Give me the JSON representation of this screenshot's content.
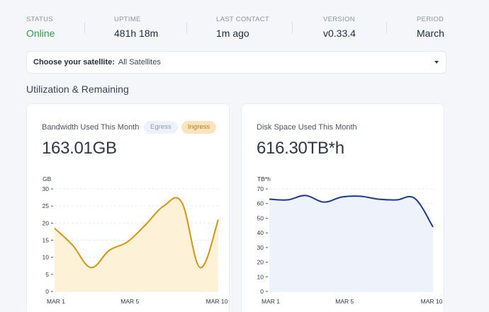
{
  "status": {
    "items": [
      {
        "label": "STATUS",
        "value": "Online"
      },
      {
        "label": "UPTIME",
        "value": "481h 18m"
      },
      {
        "label": "LAST CONTACT",
        "value": "1m ago"
      },
      {
        "label": "VERSION",
        "value": "v0.33.4"
      },
      {
        "label": "PERIOD",
        "value": "March"
      }
    ]
  },
  "satellite_selector": {
    "label": "Choose your satellite:",
    "value": "All Satellites"
  },
  "section_title": "Utilization & Remaining",
  "bandwidth_card": {
    "title": "Bandwidth Used This Month",
    "value": "163.01GB",
    "egress_label": "Egress",
    "ingress_label": "Ingress"
  },
  "disk_card": {
    "title": "Disk Space Used This Month",
    "value": "616.30TB*h"
  },
  "colors": {
    "online": "#2f9e44",
    "ingress_line": "#d4960c",
    "ingress_fill": "#fdf1d8",
    "disk_line": "#1a3a8f",
    "disk_fill": "#eef2fb"
  },
  "chart_data": [
    {
      "type": "area",
      "ylabel": "GB",
      "ylim": [
        0,
        30
      ],
      "yticks": [
        0,
        5,
        10,
        15,
        20,
        25,
        30
      ],
      "x": [
        1,
        2,
        3,
        4,
        5,
        6,
        7,
        8,
        9,
        10
      ],
      "xtick_labels": [
        "MAR 1",
        "MAR 5",
        "MAR 10"
      ],
      "series": [
        {
          "values": [
            18.5,
            13.5,
            7,
            12,
            14.5,
            19.5,
            25,
            26,
            7,
            21
          ]
        }
      ],
      "grid": true
    },
    {
      "type": "area",
      "ylabel": "TB*h",
      "ylim": [
        0,
        70
      ],
      "yticks": [
        0,
        10,
        20,
        30,
        40,
        50,
        60,
        70
      ],
      "x": [
        1,
        2,
        3,
        4,
        5,
        6,
        7,
        8,
        9,
        10
      ],
      "xtick_labels": [
        "MAR 1",
        "MAR 5",
        "MAR 10"
      ],
      "series": [
        {
          "values": [
            63,
            62.5,
            65.5,
            61,
            64.5,
            65,
            63,
            62.5,
            63.5,
            44
          ]
        }
      ],
      "grid": true
    }
  ]
}
